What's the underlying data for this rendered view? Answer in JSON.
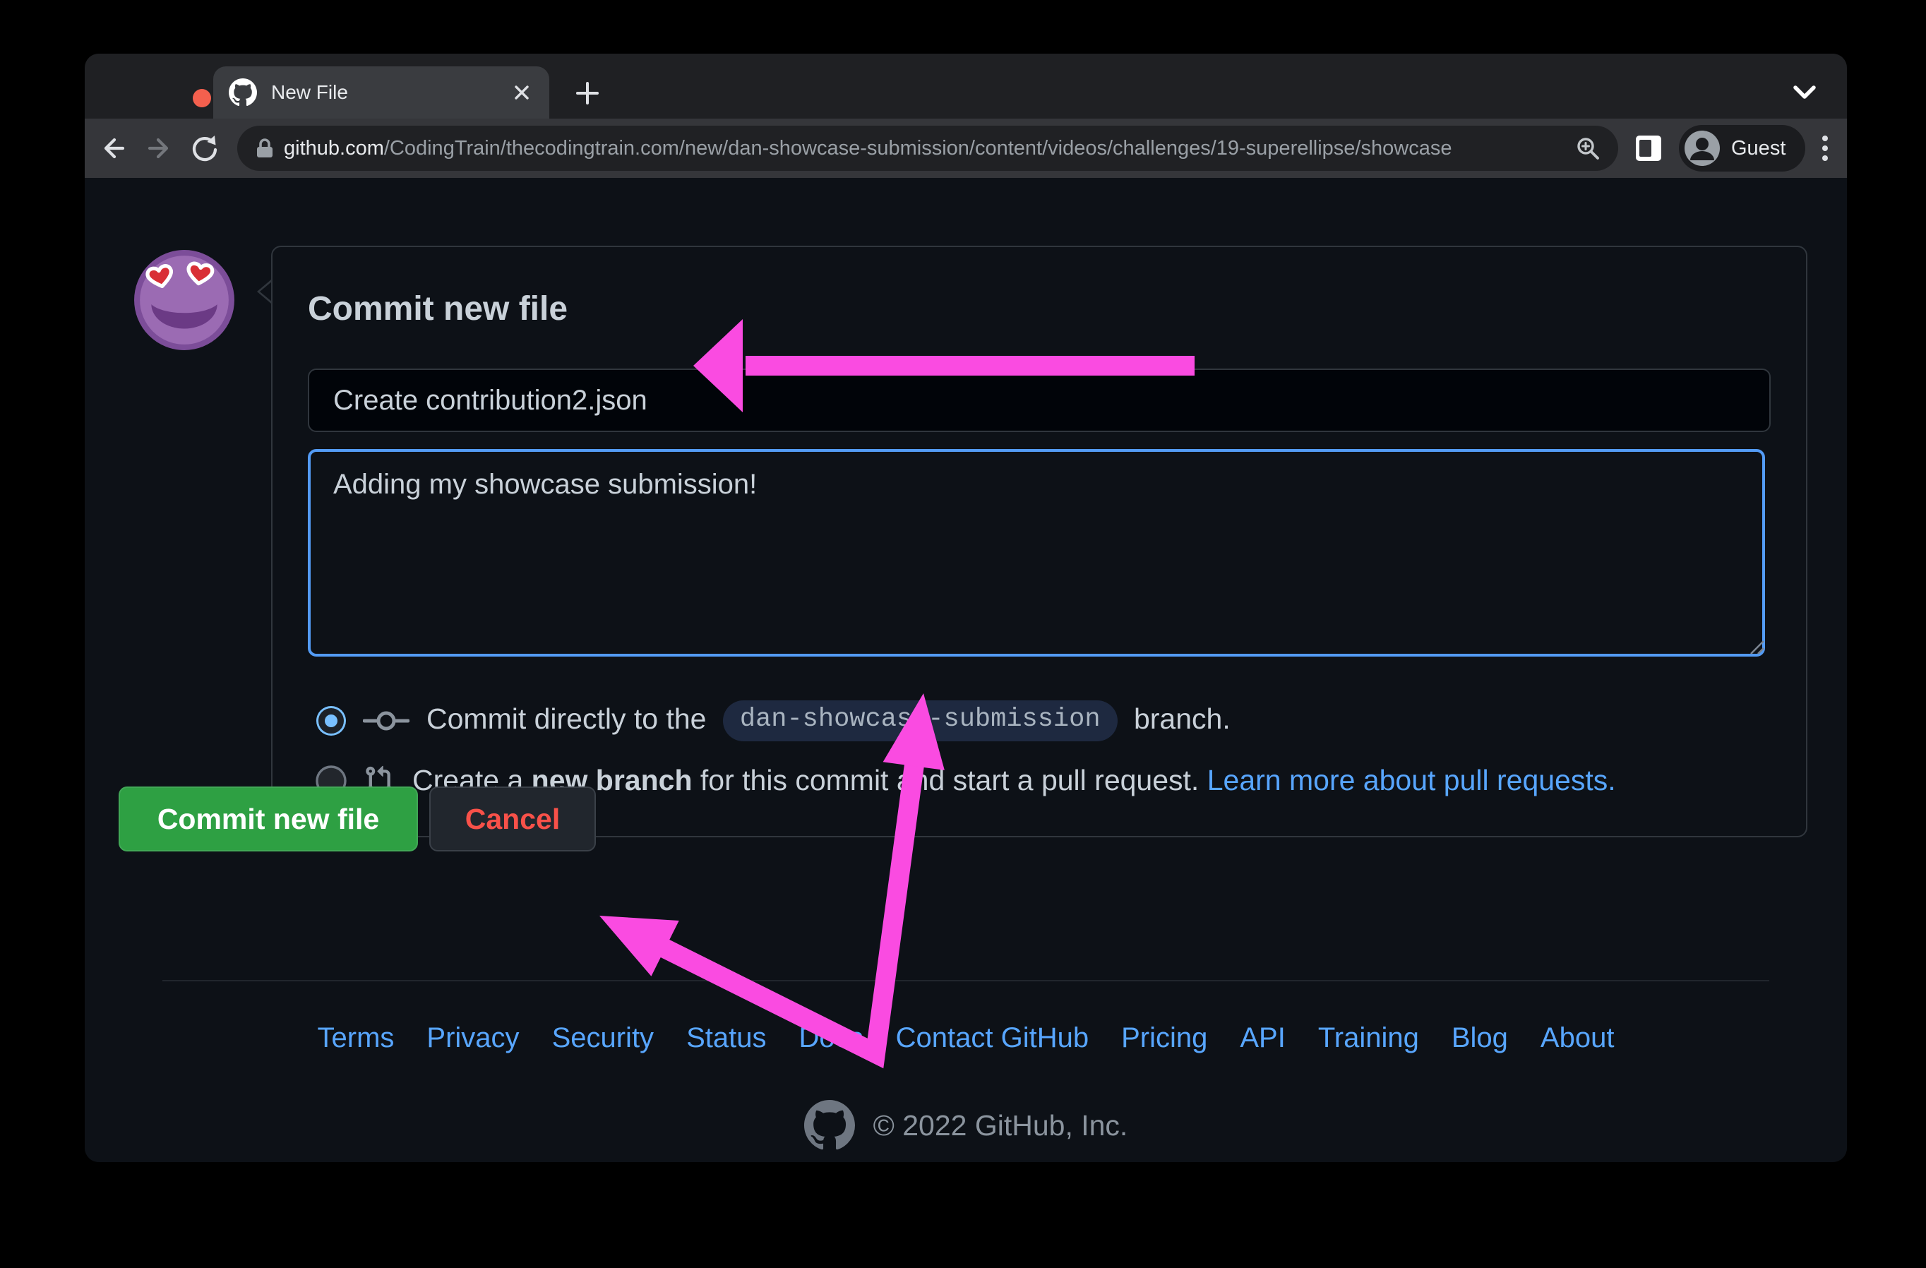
{
  "browser": {
    "tab": {
      "title": "New File",
      "favicon": "github-mark-icon"
    },
    "new_tab_button": "+",
    "url": {
      "domain": "github.com",
      "path": "/CodingTrain/thecodingtrain.com/new/dan-showcase-submission/content/videos/challenges/19-superellipse/showcase"
    },
    "profile_label": "Guest"
  },
  "page": {
    "heading": "Commit new file",
    "commit_title_input": {
      "value": "Create contribution2.json"
    },
    "description_textarea": {
      "value": "Adding my showcase submission!"
    },
    "radio_direct": {
      "selected": true,
      "text_prefix": "Commit directly to the",
      "branch_name": "dan-showcase-submission",
      "text_suffix": "branch."
    },
    "radio_new_branch": {
      "selected": false,
      "text_pre": "Create a",
      "text_bold": "new branch",
      "text_mid": "for this commit and start a pull request.",
      "link": "Learn more about pull requests."
    },
    "buttons": {
      "commit": "Commit new file",
      "cancel": "Cancel"
    },
    "footer": {
      "links": [
        "Terms",
        "Privacy",
        "Security",
        "Status",
        "Docs",
        "Contact GitHub",
        "Pricing",
        "API",
        "Training",
        "Blog",
        "About"
      ],
      "copyright": "© 2022 GitHub, Inc."
    }
  },
  "colors": {
    "annotation_pink": "#fa4be1",
    "commit_button_green": "#2ea043",
    "cancel_text_red": "#f85149",
    "link_blue": "#58a6ff",
    "focus_border_blue": "#539bf5",
    "page_background": "#0d1117",
    "card_border": "#30363d"
  }
}
